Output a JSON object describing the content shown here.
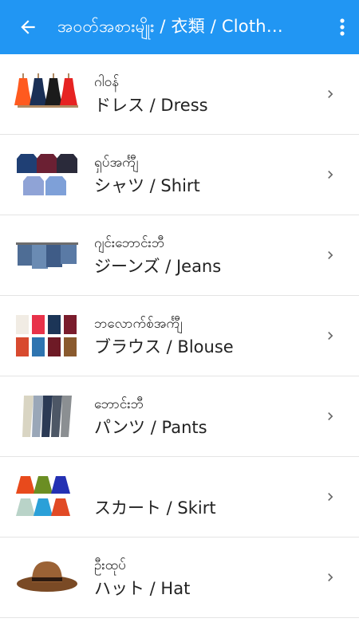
{
  "appbar": {
    "title": "အဝတ်အစားမျိုး / 衣類 / Cloth…",
    "back_icon": "arrow-left-icon",
    "menu_icon": "more-vert-icon"
  },
  "items": [
    {
      "my": "ဂါဝန်",
      "jp_line": "ドレス  /  Dress",
      "thumb": "dress-thumbnail"
    },
    {
      "my": "ရှပ်အင်္ကျီ",
      "jp_line": "シャツ  /  Shirt",
      "thumb": "shirt-thumbnail"
    },
    {
      "my": "ဂျင်းဘောင်းဘီ",
      "jp_line": "ジーンズ  /  Jeans",
      "thumb": "jeans-thumbnail"
    },
    {
      "my": "ဘလောက်စ်အင်္ကျီ",
      "jp_line": "ブラウス  /  Blouse",
      "thumb": "blouse-thumbnail"
    },
    {
      "my": "ဘောင်းဘီ",
      "jp_line": "パンツ  /  Pants",
      "thumb": "pants-thumbnail"
    },
    {
      "my": "",
      "jp_line": "スカート  /  Skirt",
      "thumb": "skirt-thumbnail"
    },
    {
      "my": "ဦးထုပ်",
      "jp_line": "ハット  /  Hat",
      "thumb": "hat-thumbnail"
    }
  ],
  "colors": {
    "appbar": "#2196F3",
    "divider": "#e4e4e4",
    "chevron": "#666666"
  }
}
